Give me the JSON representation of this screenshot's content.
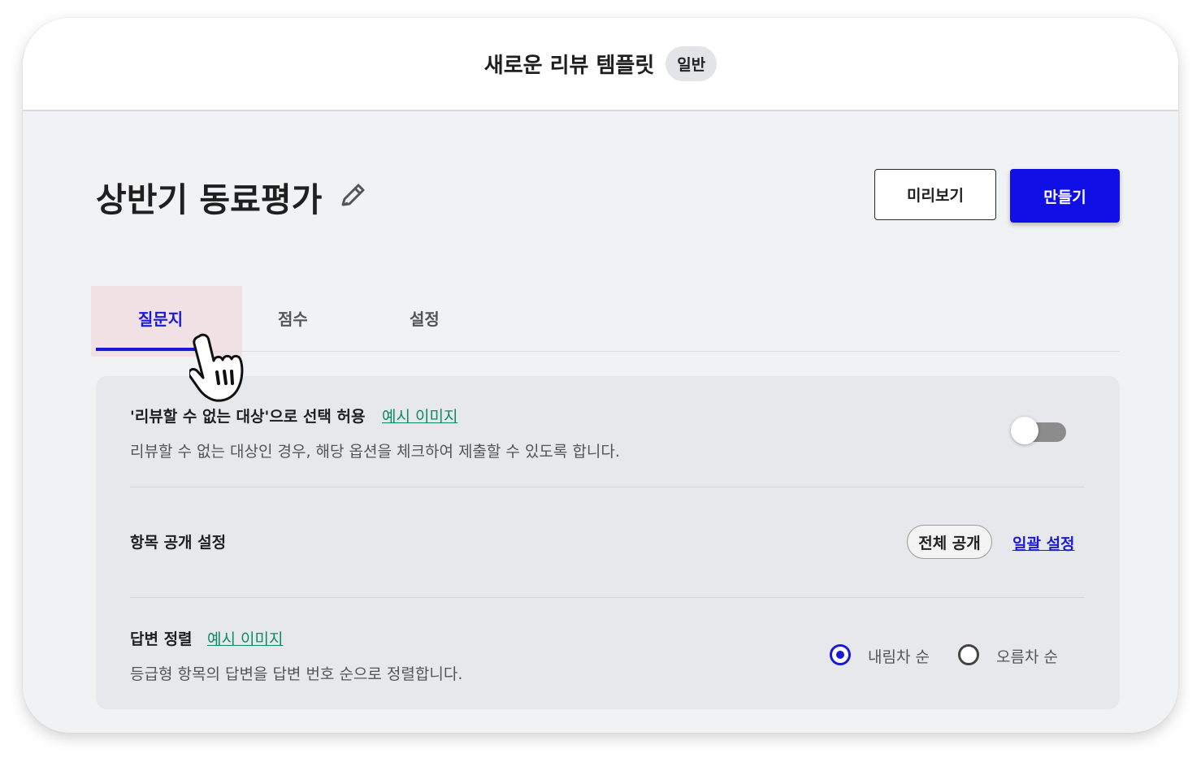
{
  "header": {
    "title": "새로운 리뷰 템플릿",
    "badge": "일반"
  },
  "page": {
    "title": "상반기 동료평가",
    "edit_icon": "pencil-icon"
  },
  "actions": {
    "preview_label": "미리보기",
    "create_label": "만들기",
    "create_color": "#1010e6"
  },
  "tabs": [
    {
      "label": "질문지",
      "active": true
    },
    {
      "label": "점수",
      "active": false
    },
    {
      "label": "설정",
      "active": false
    }
  ],
  "settings": {
    "unreviewable": {
      "title": "'리뷰할 수 없는 대상'으로 선택 허용",
      "example_link": "예시 이미지",
      "description": "리뷰할 수 없는 대상인 경우, 해당 옵션을 체크하여 제출할 수 있도록 합니다.",
      "toggle_on": false
    },
    "visibility": {
      "title": "항목 공개 설정",
      "current_value": "전체 공개",
      "bulk_link": "일괄 설정"
    },
    "sorting": {
      "title": "답변 정렬",
      "example_link": "예시 이미지",
      "description": "등급형 항목의 답변을 답변 번호 순으로 정렬합니다.",
      "options": [
        {
          "label": "내림차 순",
          "selected": true
        },
        {
          "label": "오름차 순",
          "selected": false
        }
      ]
    }
  },
  "colors": {
    "accent_blue": "#1a1ad6",
    "link_green": "#0e8a5f"
  }
}
